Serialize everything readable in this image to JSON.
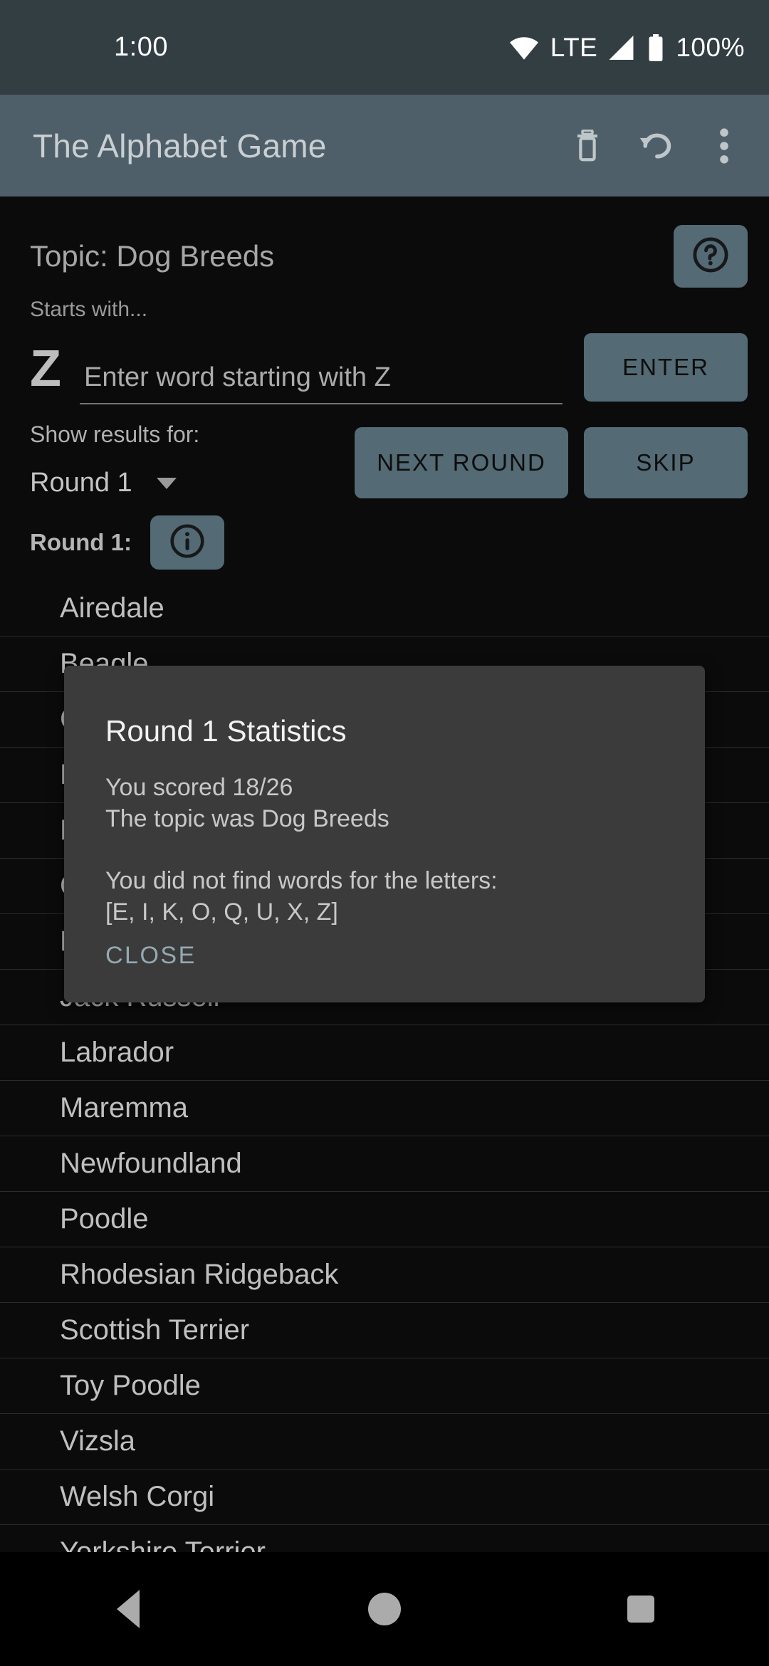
{
  "status_bar": {
    "clock": "1:00",
    "network_label": "LTE",
    "battery_percent": "100%",
    "wifi_icon": "wifi-icon",
    "signal_icon": "signal-icon",
    "battery_icon": "battery-icon"
  },
  "app_bar": {
    "title": "The Alphabet Game",
    "actions": [
      {
        "name": "delete-icon",
        "label": "Delete"
      },
      {
        "name": "undo-icon",
        "label": "Undo"
      },
      {
        "name": "overflow-menu-icon",
        "label": "More options"
      }
    ]
  },
  "main": {
    "topic_title": "Topic: Dog Breeds",
    "help_icon": "help-circle-icon",
    "starts_with_label": "Starts with...",
    "current_letter": "Z",
    "input_placeholder": "Enter word starting with Z",
    "input_value": "",
    "enter_label": "ENTER",
    "show_results_label": "Show results for:",
    "round_selector_value": "Round 1",
    "next_round_label": "NEXT ROUND",
    "skip_label": "SKIP",
    "round_heading": "Round 1:",
    "info_icon": "info-circle-icon",
    "words": [
      "Airedale",
      "Beagle",
      "Cocker Spaniel",
      "Dalmatian",
      "French Bulldog",
      "Great Dane",
      "Husky",
      "Jack Russell",
      "Labrador",
      "Maremma",
      "Newfoundland",
      "Poodle",
      "Rhodesian Ridgeback",
      "Scottish Terrier",
      "Toy Poodle",
      "Vizsla",
      "Welsh Corgi",
      "Yorkshire Terrier"
    ]
  },
  "dialog": {
    "title": "Round 1 Statistics",
    "score_line": "You scored 18/26\nThe topic was Dog Breeds",
    "missing_line": "You did not find words for the letters:\n[E, I, K, O, Q, U, X, Z]",
    "close_label": "CLOSE"
  },
  "nav_bar": {
    "back": "back-button",
    "home": "home-button",
    "recents": "recents-button"
  },
  "colors": {
    "status_bar_bg": "#333E43",
    "app_bar_bg": "#4E5F69",
    "accent_button": "#546A74",
    "dialog_bg": "#3B3B3B",
    "close_text": "#94A9B2",
    "page_bg": "#0b0b0b"
  }
}
